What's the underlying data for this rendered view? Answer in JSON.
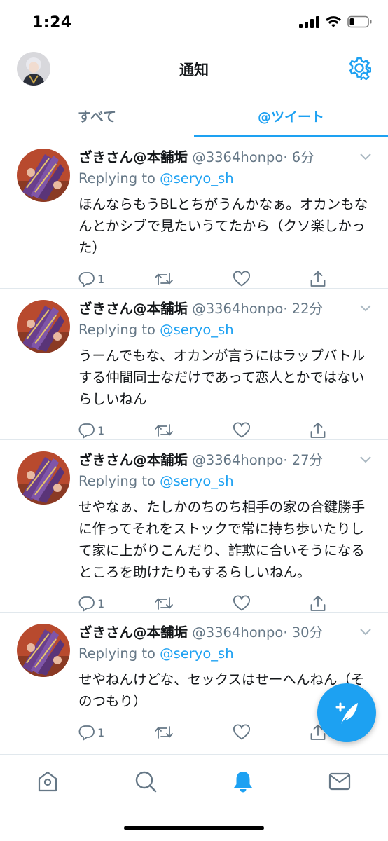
{
  "status_bar": {
    "time": "1:24"
  },
  "header": {
    "title": "通知"
  },
  "tabs": [
    {
      "label": "すべて",
      "active": false
    },
    {
      "label": "@ツイート",
      "active": true
    }
  ],
  "tweets": [
    {
      "name": "ざきさん@本舗垢",
      "handle": "@3364honpo",
      "time": "· 6分",
      "replying_prefix": "Replying to ",
      "replying_to": "@seryo_sh",
      "text": "ほんならもうBLとちがうんかなぁ。オカンもなんとかシブで見たいうてたから（クソ楽しかった）",
      "reply_count": "1"
    },
    {
      "name": "ざきさん@本舗垢",
      "handle": "@3364honpo",
      "time": "· 22分",
      "replying_prefix": "Replying to ",
      "replying_to": "@seryo_sh",
      "text": "うーんでもな、オカンが言うにはラップバトルする仲間同士なだけであって恋人とかではないらしいねん",
      "reply_count": "1"
    },
    {
      "name": "ざきさん@本舗垢",
      "handle": "@3364honpo",
      "time": "· 27分",
      "replying_prefix": "Replying to ",
      "replying_to": "@seryo_sh",
      "text": "せやなぁ、たしかのちのち相手の家の合鍵勝手に作ってそれをストックで常に持ち歩いたりして家に上がりこんだり、詐欺に合いそうになるところを助けたりもするらしいねん。",
      "reply_count": "1"
    },
    {
      "name": "ざきさん@本舗垢",
      "handle": "@3364honpo",
      "time": "· 30分",
      "replying_prefix": "Replying to ",
      "replying_to": "@seryo_sh",
      "text": "せやねんけどな、セックスはせーへんねん（そのつもり）",
      "reply_count": "1"
    }
  ],
  "colors": {
    "accent": "#1da1f2",
    "secondary_text": "#657786",
    "divider": "#e1e8ed"
  },
  "icons": {
    "settings": "gear-icon",
    "reply": "reply-icon",
    "retweet": "retweet-icon",
    "like": "heart-icon",
    "share": "share-icon",
    "compose": "compose-tweet-icon",
    "nav": [
      "home-icon",
      "search-icon",
      "bell-icon",
      "mail-icon"
    ]
  }
}
